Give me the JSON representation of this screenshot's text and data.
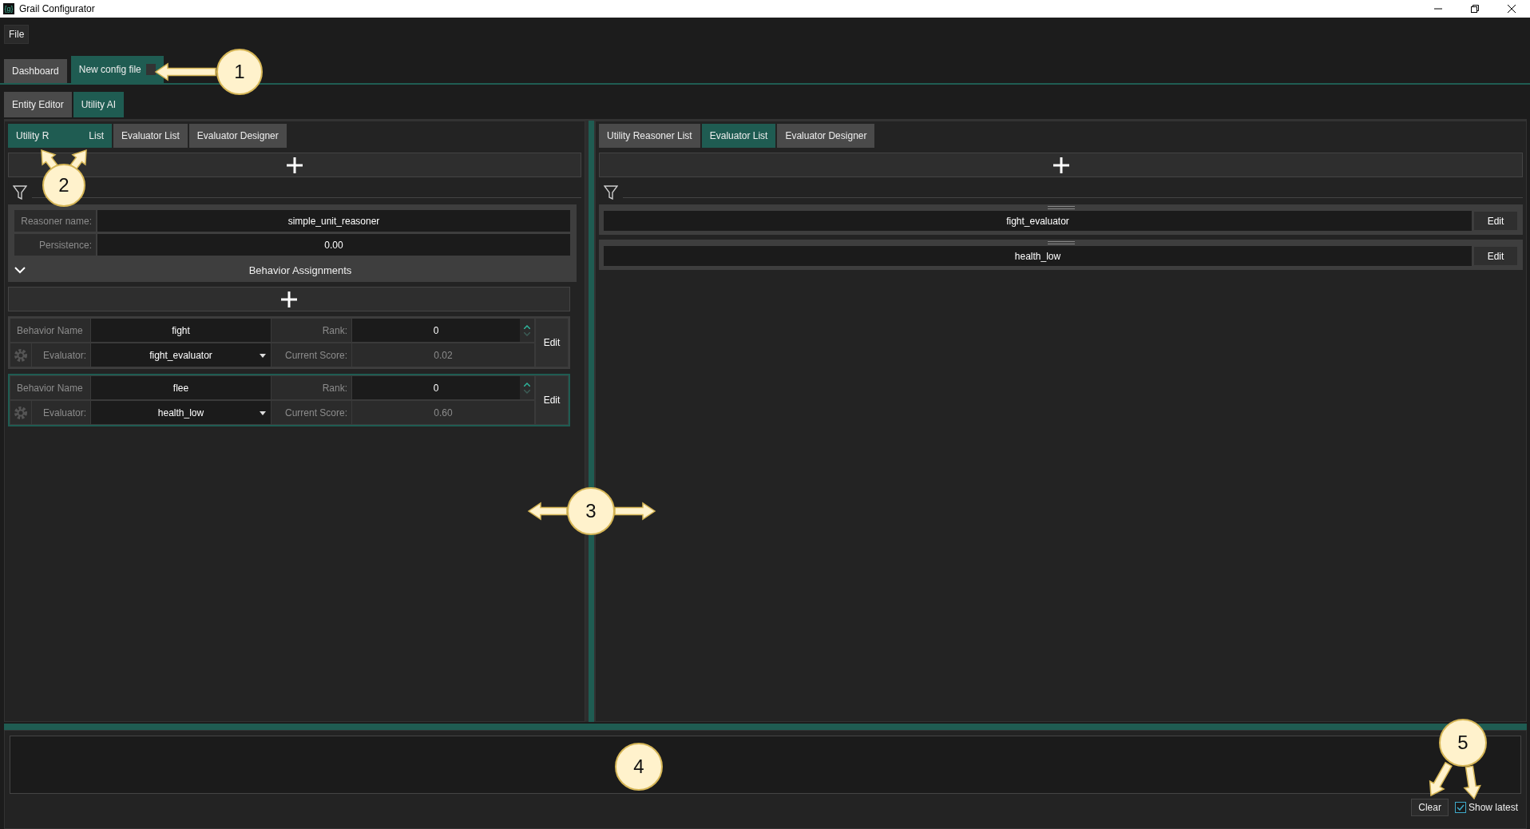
{
  "window": {
    "icon_text": "{g}",
    "title": "Grail Configurator"
  },
  "menu": [
    {
      "label": "File"
    }
  ],
  "document_tabs": [
    {
      "label": "Dashboard",
      "selected": false,
      "closable": false
    },
    {
      "label": "New config file",
      "selected": true,
      "closable": true
    }
  ],
  "editor_tabs": [
    {
      "label": "Entity Editor",
      "selected": false
    },
    {
      "label": "Utility AI",
      "selected": true
    }
  ],
  "left_panel": {
    "tabs": [
      {
        "label_parts": [
          "Utility R",
          "List"
        ],
        "selected": true
      },
      {
        "label_parts": [
          "Evaluator List"
        ],
        "selected": false
      },
      {
        "label_parts": [
          "Evaluator Designer"
        ],
        "selected": false
      }
    ],
    "reasoner_fields": [
      {
        "label": "Reasoner name:",
        "value": "simple_unit_reasoner"
      },
      {
        "label": "Persistence:",
        "value": "0.00"
      }
    ],
    "section": {
      "title": "Behavior Assignments",
      "expanded": true
    },
    "behaviors": [
      {
        "name_label": "Behavior Name",
        "name": "fight",
        "rank_label": "Rank:",
        "rank": "0",
        "evaluator_label": "Evaluator:",
        "evaluator": "fight_evaluator",
        "score_label": "Current Score:",
        "score": "0.02",
        "edit": "Edit",
        "selected": false
      },
      {
        "name_label": "Behavior Name",
        "name": "flee",
        "rank_label": "Rank:",
        "rank": "0",
        "evaluator_label": "Evaluator:",
        "evaluator": "health_low",
        "score_label": "Current Score:",
        "score": "0.60",
        "edit": "Edit",
        "selected": true
      }
    ]
  },
  "right_panel": {
    "tabs": [
      {
        "label": "Utility Reasoner List",
        "selected": false
      },
      {
        "label": "Evaluator List",
        "selected": true
      },
      {
        "label": "Evaluator Designer",
        "selected": false
      }
    ],
    "evaluators": [
      {
        "name": "fight_evaluator",
        "edit": "Edit"
      },
      {
        "name": "health_low",
        "edit": "Edit"
      }
    ]
  },
  "log": {
    "clear": "Clear",
    "show_latest": {
      "label": "Show latest",
      "checked": true
    }
  },
  "callouts": [
    {
      "label": "1"
    },
    {
      "label": "2"
    },
    {
      "label": "3"
    },
    {
      "label": "4"
    },
    {
      "label": "5"
    }
  ]
}
